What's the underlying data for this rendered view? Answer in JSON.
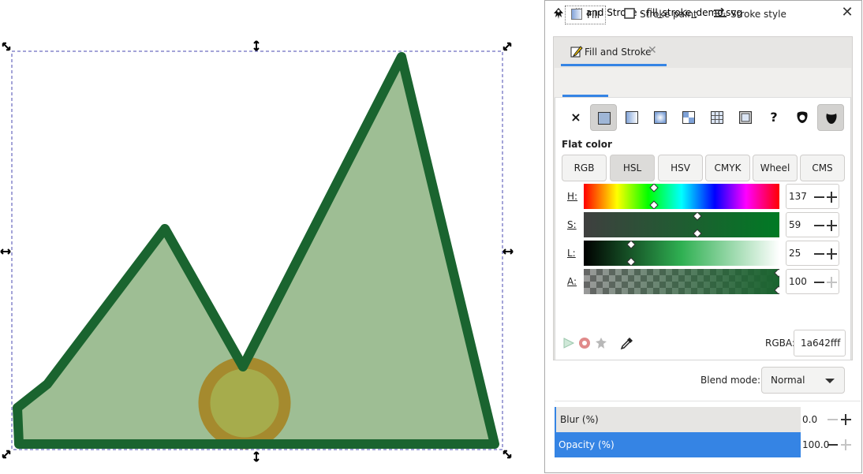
{
  "window": {
    "title": "Fill and Stroke - fill_stroke_demo.svg",
    "close_icon": "close-icon"
  },
  "panel_tab": {
    "label": "Fill and Stroke",
    "icon": "pen-icon"
  },
  "subtabs": [
    {
      "label": "Fill",
      "icon": "fill-icon",
      "active": true
    },
    {
      "label": "Stroke paint",
      "icon": "stroke-paint-icon",
      "active": false
    },
    {
      "label": "Stroke style",
      "icon": "stroke-style-icon",
      "active": false
    }
  ],
  "paint_buttons": [
    {
      "name": "no-paint",
      "glyph": "×"
    },
    {
      "name": "flat-color",
      "selected": true
    },
    {
      "name": "linear-gradient"
    },
    {
      "name": "radial-gradient"
    },
    {
      "name": "pattern"
    },
    {
      "name": "mesh-gradient"
    },
    {
      "name": "swatch"
    },
    {
      "name": "unset",
      "glyph": "?"
    },
    {
      "name": "fill-rule-evenodd"
    },
    {
      "name": "fill-rule-nonzero",
      "selected": true
    }
  ],
  "flat_color_label": "Flat color",
  "modes": [
    "RGB",
    "HSL",
    "HSV",
    "CMYK",
    "Wheel",
    "CMS"
  ],
  "active_mode": "HSL",
  "sliders": [
    {
      "label": "H:",
      "value": "137"
    },
    {
      "label": "S:",
      "value": "59"
    },
    {
      "label": "L:",
      "value": "25"
    },
    {
      "label": "A:",
      "value": "100"
    }
  ],
  "rgba": {
    "label": "RGBA:",
    "value": "1a642fff"
  },
  "blend": {
    "label": "Blend mode:",
    "value": "Normal"
  },
  "blur": {
    "label": "Blur (%)",
    "value": "0.0"
  },
  "opacity": {
    "label": "Opacity (%)",
    "value": "100.0"
  },
  "colors": {
    "shape_fill": "#9ebe94",
    "shape_stroke": "#1a642f",
    "circle_fill": "#a6ac4c",
    "circle_stroke": "#a58a2e",
    "accent": "#3584e4",
    "selected_row": "#3584e4"
  }
}
